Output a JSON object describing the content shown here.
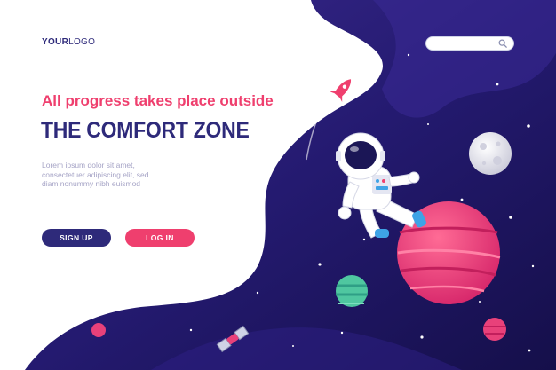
{
  "header": {
    "logo_bold": "YOUR",
    "logo_light": "LOGO"
  },
  "search": {
    "placeholder": "",
    "icon": "search-icon"
  },
  "hero": {
    "tagline": "All progress takes place outside",
    "headline": "THE COMFORT ZONE",
    "body_lines": [
      "Lorem ipsum dolor sit amet,",
      "consectetuer adipiscing elit, sed",
      "diam nonummy nibh euismod"
    ]
  },
  "actions": {
    "signup_label": "SIGN UP",
    "login_label": "LOG IN"
  },
  "colors": {
    "brand_navy": "#2e2a7a",
    "accent_pink": "#ef3f6e",
    "space_dark": "#1c1860",
    "planet_pink": "#e8417a",
    "planet_green": "#4fc7a0",
    "moon_grey": "#e3e3ec"
  },
  "illustration": {
    "icons": [
      "rocket-icon",
      "astronaut-icon",
      "planet-icon",
      "moon-icon",
      "satellite-icon",
      "star-icon"
    ]
  }
}
